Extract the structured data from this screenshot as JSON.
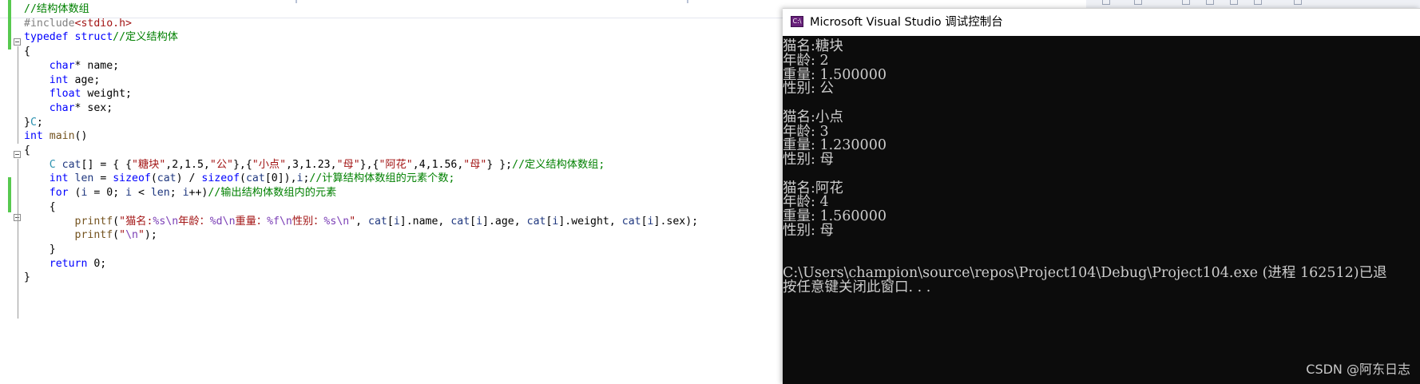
{
  "editor": {
    "lines": [
      [
        {
          "t": "//结构体数组",
          "c": "cm"
        }
      ],
      [
        {
          "t": "#include",
          "c": "pp"
        },
        {
          "t": "<stdio.h>",
          "c": "st"
        }
      ],
      [
        {
          "t": "typedef",
          "c": "kw"
        },
        {
          "t": " ",
          "c": ""
        },
        {
          "t": "struct",
          "c": "kw"
        },
        {
          "t": "//定义结构体",
          "c": "cm"
        }
      ],
      [
        {
          "t": "{",
          "c": ""
        }
      ],
      [
        {
          "t": "    ",
          "c": ""
        },
        {
          "t": "char",
          "c": "kw"
        },
        {
          "t": "* name;",
          "c": ""
        }
      ],
      [
        {
          "t": "    ",
          "c": ""
        },
        {
          "t": "int",
          "c": "kw"
        },
        {
          "t": " age;",
          "c": ""
        }
      ],
      [
        {
          "t": "    ",
          "c": ""
        },
        {
          "t": "float",
          "c": "kw"
        },
        {
          "t": " weight;",
          "c": ""
        }
      ],
      [
        {
          "t": "    ",
          "c": ""
        },
        {
          "t": "char",
          "c": "kw"
        },
        {
          "t": "* sex;",
          "c": ""
        }
      ],
      [
        {
          "t": "}",
          "c": ""
        },
        {
          "t": "C",
          "c": "ty"
        },
        {
          "t": ";",
          "c": ""
        }
      ],
      [
        {
          "t": "int",
          "c": "kw"
        },
        {
          "t": " ",
          "c": ""
        },
        {
          "t": "main",
          "c": "fn"
        },
        {
          "t": "()",
          "c": ""
        }
      ],
      [
        {
          "t": "{",
          "c": ""
        }
      ],
      [
        {
          "t": "    ",
          "c": ""
        },
        {
          "t": "C",
          "c": "ty"
        },
        {
          "t": " ",
          "c": ""
        },
        {
          "t": "cat",
          "c": "id"
        },
        {
          "t": "[] = { {",
          "c": ""
        },
        {
          "t": "\"糖块\"",
          "c": "st"
        },
        {
          "t": ",2,1.5,",
          "c": ""
        },
        {
          "t": "\"公\"",
          "c": "st"
        },
        {
          "t": "},{",
          "c": ""
        },
        {
          "t": "\"小点\"",
          "c": "st"
        },
        {
          "t": ",3,1.23,",
          "c": ""
        },
        {
          "t": "\"母\"",
          "c": "st"
        },
        {
          "t": "},{",
          "c": ""
        },
        {
          "t": "\"阿花\"",
          "c": "st"
        },
        {
          "t": ",4,1.56,",
          "c": ""
        },
        {
          "t": "\"母\"",
          "c": "st"
        },
        {
          "t": "} };",
          "c": ""
        },
        {
          "t": "//定义结构体数组;",
          "c": "cm"
        }
      ],
      [
        {
          "t": "    ",
          "c": ""
        },
        {
          "t": "int",
          "c": "kw"
        },
        {
          "t": " ",
          "c": ""
        },
        {
          "t": "len",
          "c": "id"
        },
        {
          "t": " = ",
          "c": ""
        },
        {
          "t": "sizeof",
          "c": "kw"
        },
        {
          "t": "(",
          "c": ""
        },
        {
          "t": "cat",
          "c": "id"
        },
        {
          "t": ") / ",
          "c": ""
        },
        {
          "t": "sizeof",
          "c": "kw"
        },
        {
          "t": "(",
          "c": ""
        },
        {
          "t": "cat",
          "c": "id"
        },
        {
          "t": "[0]),",
          "c": ""
        },
        {
          "t": "i",
          "c": "id"
        },
        {
          "t": ";",
          "c": ""
        },
        {
          "t": "//计算结构体数组的元素个数;",
          "c": "cm"
        }
      ],
      [
        {
          "t": "    ",
          "c": ""
        },
        {
          "t": "for",
          "c": "kw"
        },
        {
          "t": " (",
          "c": ""
        },
        {
          "t": "i",
          "c": "id"
        },
        {
          "t": " = 0; ",
          "c": ""
        },
        {
          "t": "i",
          "c": "id"
        },
        {
          "t": " < ",
          "c": ""
        },
        {
          "t": "len",
          "c": "id"
        },
        {
          "t": "; ",
          "c": ""
        },
        {
          "t": "i",
          "c": "id"
        },
        {
          "t": "++)",
          "c": ""
        },
        {
          "t": "//输出结构体数组内的元素",
          "c": "cm"
        }
      ],
      [
        {
          "t": "    {",
          "c": ""
        }
      ],
      [
        {
          "t": "        ",
          "c": ""
        },
        {
          "t": "printf",
          "c": "fn"
        },
        {
          "t": "(",
          "c": ""
        },
        {
          "t": "\"猫名:",
          "c": "st"
        },
        {
          "t": "%s",
          "c": "fmt"
        },
        {
          "t": "\\n",
          "c": "fmt"
        },
        {
          "t": "年龄：",
          "c": "st"
        },
        {
          "t": "%d",
          "c": "fmt"
        },
        {
          "t": "\\n",
          "c": "fmt"
        },
        {
          "t": "重量：",
          "c": "st"
        },
        {
          "t": "%f",
          "c": "fmt"
        },
        {
          "t": "\\n",
          "c": "fmt"
        },
        {
          "t": "性别：",
          "c": "st"
        },
        {
          "t": "%s",
          "c": "fmt"
        },
        {
          "t": "\\n",
          "c": "fmt"
        },
        {
          "t": "\"",
          "c": "st"
        },
        {
          "t": ", ",
          "c": ""
        },
        {
          "t": "cat",
          "c": "id"
        },
        {
          "t": "[",
          "c": ""
        },
        {
          "t": "i",
          "c": "id"
        },
        {
          "t": "].name, ",
          "c": ""
        },
        {
          "t": "cat",
          "c": "id"
        },
        {
          "t": "[",
          "c": ""
        },
        {
          "t": "i",
          "c": "id"
        },
        {
          "t": "].age, ",
          "c": ""
        },
        {
          "t": "cat",
          "c": "id"
        },
        {
          "t": "[",
          "c": ""
        },
        {
          "t": "i",
          "c": "id"
        },
        {
          "t": "].weight, ",
          "c": ""
        },
        {
          "t": "cat",
          "c": "id"
        },
        {
          "t": "[",
          "c": ""
        },
        {
          "t": "i",
          "c": "id"
        },
        {
          "t": "].sex);",
          "c": ""
        }
      ],
      [
        {
          "t": "        ",
          "c": ""
        },
        {
          "t": "printf",
          "c": "fn"
        },
        {
          "t": "(",
          "c": ""
        },
        {
          "t": "\"",
          "c": "st"
        },
        {
          "t": "\\n",
          "c": "fmt"
        },
        {
          "t": "\"",
          "c": "st"
        },
        {
          "t": ");",
          "c": ""
        }
      ],
      [
        {
          "t": "    }",
          "c": ""
        }
      ],
      [
        {
          "t": "    ",
          "c": ""
        },
        {
          "t": "return",
          "c": "kw"
        },
        {
          "t": " 0;",
          "c": ""
        }
      ],
      [
        {
          "t": "}",
          "c": ""
        }
      ]
    ]
  },
  "console": {
    "title": "Microsoft Visual Studio 调试控制台",
    "icon_label": "C:\\",
    "lines": [
      "猫名:糖块",
      "年龄: 2",
      "重量: 1.500000",
      "性别: 公",
      "",
      "猫名:小点",
      "年龄: 3",
      "重量: 1.230000",
      "性别: 母",
      "",
      "猫名:阿花",
      "年龄: 4",
      "重量: 1.560000",
      "性别: 母",
      "",
      "",
      "C:\\Users\\champion\\source\\repos\\Project104\\Debug\\Project104.exe (进程 162512)已退",
      "按任意键关闭此窗口. . ."
    ]
  },
  "watermark": "CSDN @阿东日志",
  "colors": {
    "keyword": "#0000ff",
    "comment": "#008000",
    "string": "#a31515",
    "type": "#2b91af",
    "console_bg": "#0c0c0c",
    "console_fg": "#cccccc",
    "change_marker": "#57c94f"
  }
}
